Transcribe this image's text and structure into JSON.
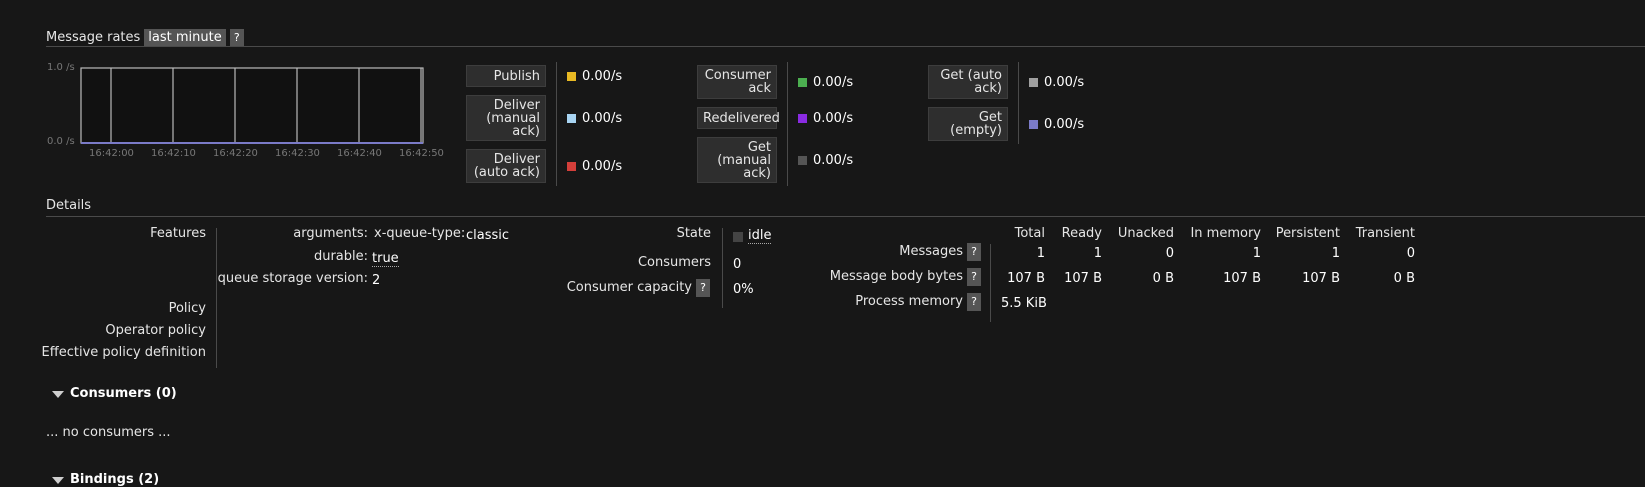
{
  "message_rates": {
    "title": "Message rates",
    "range": "last minute",
    "help": "?",
    "chart": {
      "y_max_label": "1.0 /s",
      "y_min_label": "0.0 /s",
      "x_ticks": [
        "16:42:00",
        "16:42:10",
        "16:42:20",
        "16:42:30",
        "16:42:40",
        "16:42:50"
      ]
    },
    "legend": [
      {
        "label": "Publish",
        "value": "0.00/s",
        "color": "#e8b923"
      },
      {
        "label": "Deliver (manual ack)",
        "value": "0.00/s",
        "color": "#a8d4f2"
      },
      {
        "label": "Deliver (auto ack)",
        "value": "0.00/s",
        "color": "#d43f3a"
      },
      {
        "label": "Consumer ack",
        "value": "0.00/s",
        "color": "#4caf50"
      },
      {
        "label": "Redelivered",
        "value": "0.00/s",
        "color": "#8a2be2"
      },
      {
        "label": "Get (manual ack)",
        "value": "0.00/s",
        "color": "#555555"
      },
      {
        "label": "Get (auto ack)",
        "value": "0.00/s",
        "color": "#a0a0a0"
      },
      {
        "label": "Get (empty)",
        "value": "0.00/s",
        "color": "#7b7bc8"
      }
    ]
  },
  "chart_data": {
    "type": "line",
    "x": [
      "16:42:00",
      "16:42:10",
      "16:42:20",
      "16:42:30",
      "16:42:40",
      "16:42:50"
    ],
    "ylim": [
      0,
      1.0
    ],
    "series": [
      {
        "name": "Publish",
        "values": [
          0,
          0,
          0,
          0,
          0,
          0
        ]
      },
      {
        "name": "Get (empty)",
        "values": [
          0,
          0,
          0,
          0,
          0,
          0
        ]
      }
    ]
  },
  "details": {
    "title": "Details",
    "features_label": "Features",
    "arguments_label": "arguments:",
    "arguments_key": "x-queue-type:",
    "arguments_value": "classic",
    "durable_label": "durable:",
    "durable_value": "true",
    "storage_label": "queue storage version:",
    "storage_value": "2",
    "policy_label": "Policy",
    "operator_policy_label": "Operator policy",
    "effective_policy_label": "Effective policy definition",
    "state_label": "State",
    "state_value": "idle",
    "consumers_label": "Consumers",
    "consumers_value": "0",
    "capacity_label": "Consumer capacity",
    "capacity_value": "0%",
    "help": "?",
    "stats_headers": [
      "Total",
      "Ready",
      "Unacked",
      "In memory",
      "Persistent",
      "Transient"
    ],
    "messages_label": "Messages",
    "messages_values": [
      "1",
      "1",
      "0",
      "1",
      "1",
      "0"
    ],
    "body_bytes_label": "Message body bytes",
    "body_bytes_values": [
      "107 B",
      "107 B",
      "0 B",
      "107 B",
      "107 B",
      "0 B"
    ],
    "process_memory_label": "Process memory",
    "process_memory_value": "5.5 KiB"
  },
  "consumers": {
    "title": "Consumers (0)",
    "empty_text": "... no consumers ..."
  },
  "bindings": {
    "title": "Bindings (2)"
  }
}
